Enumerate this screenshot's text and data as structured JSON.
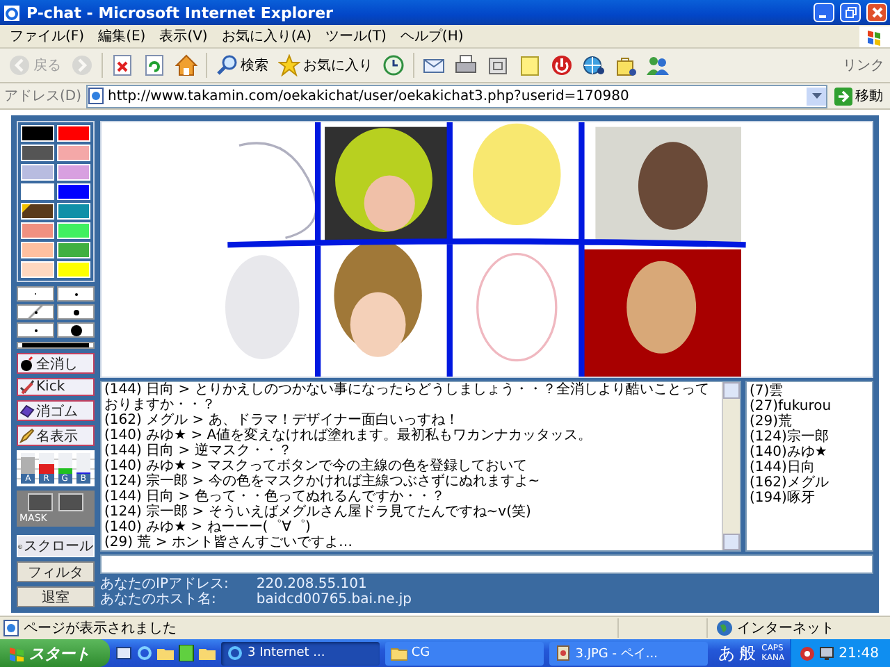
{
  "window": {
    "title": "P-chat - Microsoft Internet Explorer"
  },
  "menu": [
    "ファイル(F)",
    "編集(E)",
    "表示(V)",
    "お気に入り(A)",
    "ツール(T)",
    "ヘルプ(H)"
  ],
  "toolbar": [
    {
      "kind": "back",
      "label": "戻る",
      "disabled": true
    },
    {
      "kind": "forward",
      "disabled": true
    },
    {
      "kind": "stop",
      "disabled": false
    },
    {
      "kind": "refresh",
      "disabled": false
    },
    {
      "kind": "home",
      "disabled": false
    },
    {
      "kind": "search",
      "label": "検索",
      "disabled": false
    },
    {
      "kind": "favorites",
      "label": "お気に入り",
      "disabled": false
    },
    {
      "kind": "history",
      "disabled": false
    },
    {
      "kind": "mail",
      "disabled": false
    },
    {
      "kind": "print",
      "disabled": false
    },
    {
      "kind": "window",
      "disabled": false
    },
    {
      "kind": "note",
      "disabled": false
    },
    {
      "kind": "record",
      "disabled": false
    },
    {
      "kind": "network",
      "disabled": false
    },
    {
      "kind": "bag",
      "disabled": false
    },
    {
      "kind": "people",
      "disabled": false
    }
  ],
  "links": "リンク",
  "address": {
    "label": "アドレス(D)",
    "value": "http://www.takamin.com/oekakichat/user/oekakichat3.php?userid=170980",
    "go": "移動"
  },
  "palette": [
    {
      "color": "#000000",
      "selected": false
    },
    {
      "color": "#ff0000",
      "selected": false
    },
    {
      "color": "#555555",
      "selected": false
    },
    {
      "color": "#f4a8a8",
      "selected": false
    },
    {
      "color": "#b8bce0",
      "selected": false
    },
    {
      "color": "#d8a0e0",
      "selected": false
    },
    {
      "color": "#ffffff",
      "selected": false
    },
    {
      "color": "#0000ff",
      "selected": false
    },
    {
      "color": "#5a3a1a",
      "selected": true
    },
    {
      "color": "#1090a8",
      "selected": false
    },
    {
      "color": "#f09080",
      "selected": false
    },
    {
      "color": "#40f060",
      "selected": false
    },
    {
      "color": "#ffc0a0",
      "selected": false
    },
    {
      "color": "#40b040",
      "selected": false
    },
    {
      "color": "#ffd8c0",
      "selected": false
    },
    {
      "color": "#ffff00",
      "selected": false
    }
  ],
  "pens": [
    {
      "selected": false
    },
    {
      "selected": false
    },
    {
      "selected": true
    },
    {
      "selected": false
    },
    {
      "selected": false
    },
    {
      "selected": false
    }
  ],
  "tools": [
    {
      "kind": "clear",
      "label": "全消し"
    },
    {
      "kind": "kick",
      "label": "Kick"
    },
    {
      "kind": "eraser",
      "label": "消ゴム"
    },
    {
      "kind": "names",
      "label": "名表示"
    }
  ],
  "meter": [
    {
      "label": "A",
      "level": 0.8
    },
    {
      "label": "R",
      "level": 0.45
    },
    {
      "label": "G",
      "level": 0.3
    },
    {
      "label": "B",
      "level": 0.08
    }
  ],
  "mask": {
    "label": "MASK"
  },
  "scroll_button": "スクロール",
  "filter_button": "フィルタ",
  "exit_button": "退室",
  "chat": [
    "(144) 日向 > とりかえしのつかない事になったらどうしましょう・・？全消しより酷いことっておりますか・・？",
    "(162) メグル > あ、ドラマ！デザイナー面白いっすね！",
    "(140) みゆ★ > A値を変えなければ塗れます。最初私もワカンナカッタッス。",
    "(144) 日向 > 逆マスク・・？",
    "(140) みゆ★ > マスクってボタンで今の主線の色を登録しておいて",
    "(124) 宗一郎 > 今の色をマスクかければ主線つぶさずにぬれますよ~",
    "(144) 日向 > 色って・・色ってぬれるんですか・・？",
    "(124) 宗一郎 > そういえばメグルさん屋ドラ見てたんですね~v(笑)",
    "(140) みゆ★ > ねーーー(゜∀゜)",
    "(29) 荒 > ホント皆さんすごいですよ…"
  ],
  "users": [
    "(7)雲",
    "(27)fukurou",
    "(29)荒",
    "(124)宗一郎",
    "(140)みゆ★",
    "(144)日向",
    "(162)メグル",
    "(194)啄牙"
  ],
  "info": [
    {
      "label": "あなたのIPアドレス:",
      "value": "220.208.55.101"
    },
    {
      "label": "あなたのホスト名:",
      "value": "baidcd00765.bai.ne.jp"
    }
  ],
  "status_bar": {
    "text": "ページが表示されました",
    "zone": "インターネット"
  },
  "taskbar": {
    "start": "スタート",
    "tasks": [
      {
        "label": "3 Internet ...",
        "kind": "ie",
        "selected": true
      },
      {
        "label": "CG",
        "kind": "folder",
        "selected": false
      },
      {
        "label": "3.JPG - ペイ...",
        "kind": "paint",
        "selected": false
      }
    ],
    "ime": [
      "あ",
      "般"
    ],
    "locks": [
      "CAPS",
      "KANA"
    ],
    "clock": "21:48"
  }
}
